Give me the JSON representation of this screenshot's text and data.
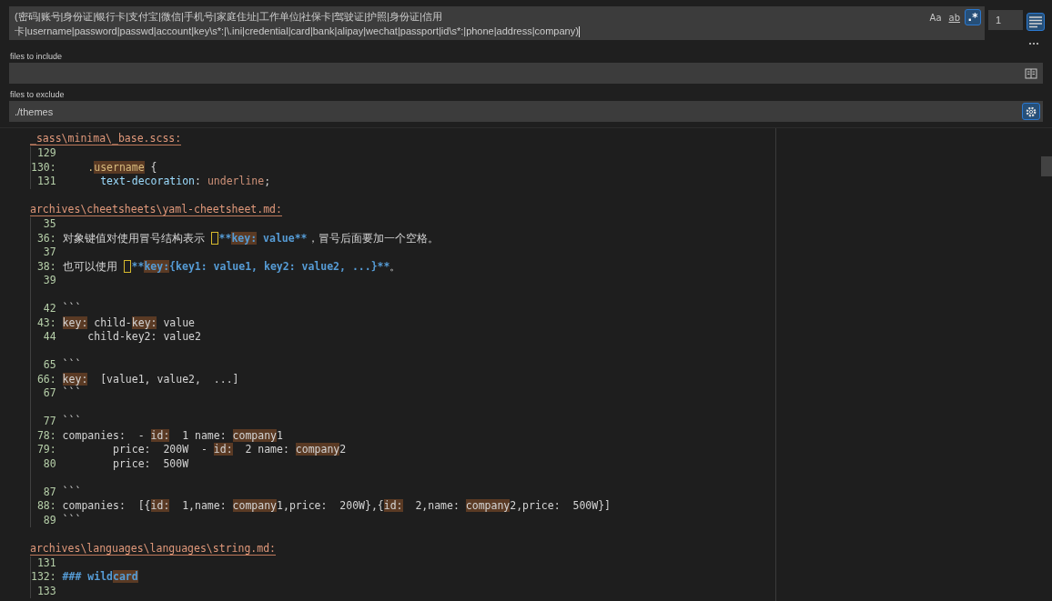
{
  "search": {
    "query": "(密码|账号|身份证|银行卡|支付宝|微信|手机号|家庭住址|工作单位|社保卡|驾驶证|护照|身份证|信用卡|username|password|passwd|account|key\\s*:|\\.ini|credential|card|bank|alipay|wechat|passport|id\\s*:|phone|address|company)",
    "options": [
      {
        "label": "Aa",
        "kind": "case",
        "selected": false
      },
      {
        "label": "ab",
        "kind": "word",
        "selected": false
      },
      {
        "label": ".*",
        "kind": "regex",
        "selected": true
      }
    ],
    "context_lines": "1",
    "context_toggle": {
      "selected": true
    }
  },
  "include": {
    "label": "files to include",
    "open_editors_only": {
      "selected": false
    }
  },
  "exclude": {
    "label": "files to exclude",
    "value": "./themes",
    "use_ignore_settings": {
      "selected": true
    }
  },
  "results": [
    {
      "file": "_sass\\minima\\_base.scss:",
      "groups": [
        [
          {
            "num": "129"
          },
          {
            "num": "130:",
            "segments": [
              {
                "text": "    .",
                "kind": "selector",
                "match": false
              },
              {
                "text": "username",
                "kind": "selector",
                "match": true
              },
              {
                "text": " {",
                "kind": "plain",
                "match": false
              }
            ]
          },
          {
            "num": "131",
            "segments": [
              {
                "text": "      text-decoration",
                "kind": "property",
                "match": false
              },
              {
                "text": ": ",
                "kind": "plain",
                "match": false
              },
              {
                "text": "underline",
                "kind": "value",
                "match": false
              },
              {
                "text": ";",
                "kind": "plain",
                "match": false
              }
            ]
          }
        ]
      ]
    },
    {
      "file": "archives\\cheetsheets\\yaml-cheetsheet.md:",
      "groups": [
        [
          {
            "num": "35"
          },
          {
            "num": "36:",
            "segments": [
              {
                "text": "对象键值对使用冒号结构表示 ",
                "kind": "plain",
                "match": false
              },
              {
                "kind": "invisible"
              },
              {
                "text": "**",
                "kind": "bold",
                "match": false
              },
              {
                "text": "key:",
                "kind": "bold",
                "match": true
              },
              {
                "text": " value**",
                "kind": "bold",
                "match": false
              },
              {
                "text": "，冒号后面要加一个空格。",
                "kind": "plain",
                "match": false
              }
            ]
          },
          {
            "num": "37"
          },
          {
            "num": "38:",
            "segments": [
              {
                "text": "也可以使用 ",
                "kind": "plain",
                "match": false
              },
              {
                "kind": "invisible"
              },
              {
                "text": "**",
                "kind": "bold",
                "match": false
              },
              {
                "text": "key:",
                "kind": "bold",
                "match": true
              },
              {
                "text": "{key1: value1, key2: value2, ...}**",
                "kind": "bold",
                "match": false
              },
              {
                "text": "。",
                "kind": "plain",
                "match": false
              }
            ]
          },
          {
            "num": "39"
          }
        ],
        [
          {
            "num": "42",
            "segments": [
              {
                "text": "```",
                "kind": "plain",
                "match": false
              }
            ]
          },
          {
            "num": "43:",
            "segments": [
              {
                "text": "key:",
                "kind": "plain",
                "match": true
              },
              {
                "text": " child-",
                "kind": "plain",
                "match": false
              },
              {
                "text": "key:",
                "kind": "plain",
                "match": true
              },
              {
                "text": " value",
                "kind": "plain",
                "match": false
              }
            ]
          },
          {
            "num": "44",
            "segments": [
              {
                "text": "    child-key2: value2",
                "kind": "plain",
                "match": false
              }
            ]
          }
        ],
        [
          {
            "num": "65",
            "segments": [
              {
                "text": "```",
                "kind": "plain",
                "match": false
              }
            ]
          },
          {
            "num": "66:",
            "segments": [
              {
                "text": "key:",
                "kind": "plain",
                "match": true
              },
              {
                "text": "  [value1, value2,  ...]",
                "kind": "plain",
                "match": false
              }
            ]
          },
          {
            "num": "67",
            "segments": [
              {
                "text": "```",
                "kind": "plain",
                "match": false
              }
            ]
          }
        ],
        [
          {
            "num": "77",
            "segments": [
              {
                "text": "```",
                "kind": "plain",
                "match": false
              }
            ]
          },
          {
            "num": "78:",
            "segments": [
              {
                "text": "companies:  - ",
                "kind": "plain",
                "match": false
              },
              {
                "text": "id:",
                "kind": "plain",
                "match": true
              },
              {
                "text": "  1 name: ",
                "kind": "plain",
                "match": false
              },
              {
                "text": "company",
                "kind": "plain",
                "match": true
              },
              {
                "text": "1",
                "kind": "plain",
                "match": false
              }
            ]
          },
          {
            "num": "79:",
            "segments": [
              {
                "text": "        price:  200W  - ",
                "kind": "plain",
                "match": false
              },
              {
                "text": "id:",
                "kind": "plain",
                "match": true
              },
              {
                "text": "  2 name: ",
                "kind": "plain",
                "match": false
              },
              {
                "text": "company",
                "kind": "plain",
                "match": true
              },
              {
                "text": "2",
                "kind": "plain",
                "match": false
              }
            ]
          },
          {
            "num": "80",
            "segments": [
              {
                "text": "        price:  500W",
                "kind": "plain",
                "match": false
              }
            ]
          }
        ],
        [
          {
            "num": "87",
            "segments": [
              {
                "text": "```",
                "kind": "plain",
                "match": false
              }
            ]
          },
          {
            "num": "88:",
            "segments": [
              {
                "text": "companies:  [{",
                "kind": "plain",
                "match": false
              },
              {
                "text": "id:",
                "kind": "plain",
                "match": true
              },
              {
                "text": "  1,name: ",
                "kind": "plain",
                "match": false
              },
              {
                "text": "company",
                "kind": "plain",
                "match": true
              },
              {
                "text": "1,price:  200W},{",
                "kind": "plain",
                "match": false
              },
              {
                "text": "id:",
                "kind": "plain",
                "match": true
              },
              {
                "text": "  2,name: ",
                "kind": "plain",
                "match": false
              },
              {
                "text": "company",
                "kind": "plain",
                "match": true
              },
              {
                "text": "2,price:  500W}]",
                "kind": "plain",
                "match": false
              }
            ]
          },
          {
            "num": "89",
            "segments": [
              {
                "text": "```",
                "kind": "plain",
                "match": false
              }
            ]
          }
        ]
      ]
    },
    {
      "file": "archives\\languages\\languages\\string.md:",
      "groups": [
        [
          {
            "num": "131"
          },
          {
            "num": "132:",
            "segments": [
              {
                "text": "### wild",
                "kind": "heading",
                "match": false
              },
              {
                "text": "card",
                "kind": "heading",
                "match": true
              }
            ]
          },
          {
            "num": "133"
          }
        ]
      ]
    }
  ]
}
